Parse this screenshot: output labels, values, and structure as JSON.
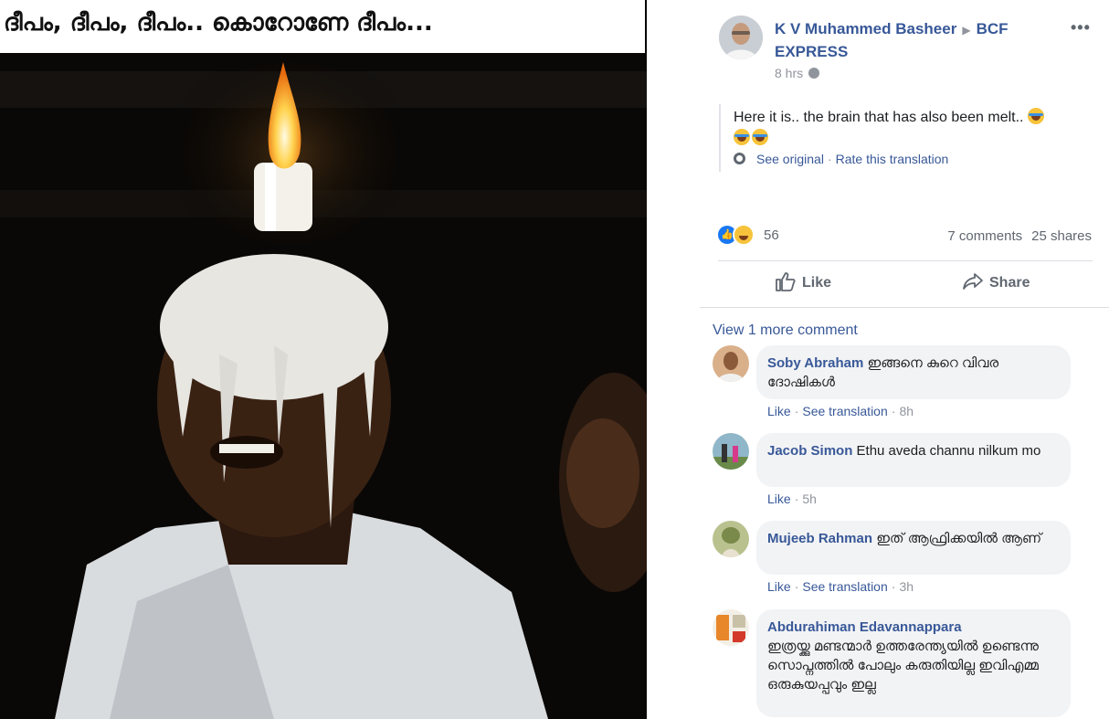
{
  "meme": {
    "caption": "ദീപം, ദീപം, ദീപം.. കൊറോണേ ദീപം..."
  },
  "post": {
    "author": "K V Muhammed Basheer",
    "group": "BCF EXPRESS",
    "time": "8 hrs",
    "text": "Here it is.. the brain that has also been melt.. ",
    "see_original": "See original",
    "rate_translation": "Rate this translation",
    "reaction_count": "56",
    "comments_count": "7 comments",
    "shares_count": "25 shares",
    "like_label": "Like",
    "share_label": "Share"
  },
  "view_more": "View 1 more comment",
  "comments": [
    {
      "name": "Soby Abraham",
      "text": "ഇങ്ങനെ കുറെ വിവര ദോഷികൾ",
      "like": "Like",
      "translate": "See translation",
      "time": "8h"
    },
    {
      "name": "Jacob Simon",
      "text": "Ethu aveda channu nilkum mo",
      "like": "Like",
      "translate": "",
      "time": "5h"
    },
    {
      "name": "Mujeeb Rahman",
      "text": "ഇത് ആഫ്രിക്കയിൽ ആണ്",
      "like": "Like",
      "translate": "See translation",
      "time": "3h"
    },
    {
      "name": "Abdurahiman Edavannappara",
      "text": "ഇത്രയ്ക്കു മണ്ടന്മാർ ഉത്തരേന്ത്യയിൽ ഉണ്ടെന്നു സൊപ്നത്തിൽ പോലും കരുതിയില്ല ഇവിഎമ്മ ഒരുകുയപ്പവും ഇല്ല",
      "like": "",
      "translate": "",
      "time": ""
    }
  ],
  "colors": {
    "link": "#385898",
    "muted": "#90949c",
    "bubble": "#f2f3f5",
    "like_blue": "#1877f2"
  }
}
